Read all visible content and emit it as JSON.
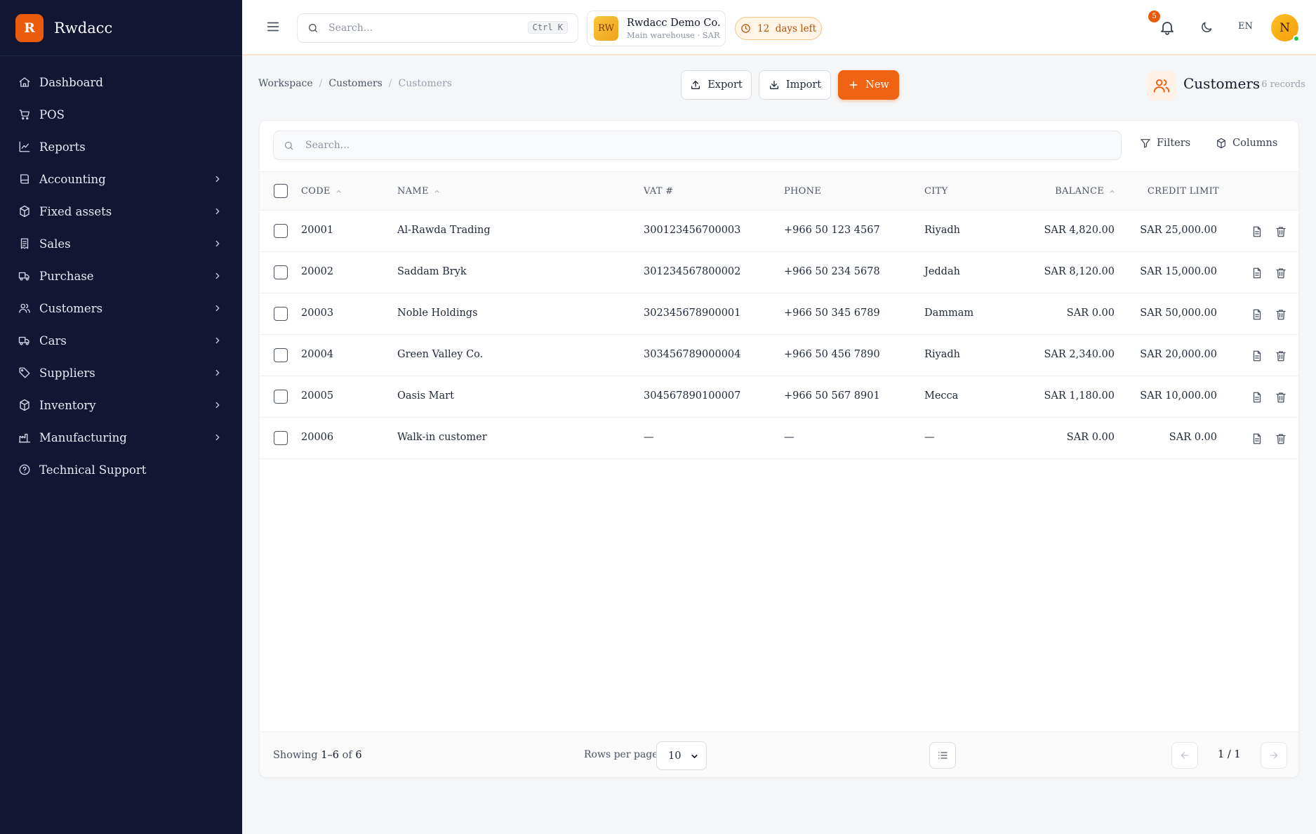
{
  "app": {
    "logo_letter": "R",
    "name": "Rwdacc"
  },
  "sidebar": {
    "items": [
      {
        "label": "Dashboard",
        "icon": "home-icon",
        "has_children": false
      },
      {
        "label": "POS",
        "icon": "cart-icon",
        "has_children": false
      },
      {
        "label": "Reports",
        "icon": "line-chart-icon",
        "has_children": false
      },
      {
        "label": "Accounting",
        "icon": "book-icon",
        "has_children": true
      },
      {
        "label": "Fixed assets",
        "icon": "box-icon",
        "has_children": true
      },
      {
        "label": "Sales",
        "icon": "receipt-icon",
        "has_children": true
      },
      {
        "label": "Purchase",
        "icon": "truck-icon",
        "has_children": true
      },
      {
        "label": "Customers",
        "icon": "users-icon",
        "has_children": true
      },
      {
        "label": "Cars",
        "icon": "car-icon",
        "has_children": true
      },
      {
        "label": "Suppliers",
        "icon": "tag-icon",
        "has_children": true
      },
      {
        "label": "Inventory",
        "icon": "package-icon",
        "has_children": true
      },
      {
        "label": "Manufacturing",
        "icon": "factory-icon",
        "has_children": true
      },
      {
        "label": "Technical Support",
        "icon": "help-circle-icon",
        "has_children": false
      }
    ]
  },
  "topbar": {
    "search_placeholder": "Search...",
    "shortcut": "Ctrl K",
    "company": {
      "avatar": "RW",
      "name": "Rwdacc Demo Co.",
      "sub": "Main warehouse · SAR"
    },
    "trial": "12  days left",
    "notifications_count": "5",
    "language": "EN",
    "user_initial": "N"
  },
  "breadcrumb": {
    "root": "Workspace",
    "section": "Customers",
    "current": "Customers"
  },
  "actions": {
    "export": "Export",
    "import": "Import",
    "new": "New"
  },
  "page": {
    "title": "Customers",
    "records": "· 6 records"
  },
  "table": {
    "search_placeholder": "Search...",
    "filters_label": "Filters",
    "columns_label": "Columns",
    "headers": {
      "code": "CODE",
      "name": "NAME",
      "vat": "VAT #",
      "phone": "PHONE",
      "city": "CITY",
      "balance": "BALANCE",
      "credit": "CREDIT LIMIT"
    },
    "rows": [
      {
        "code": "20001",
        "name": "Al-Rawda Trading",
        "vat": "300123456700003",
        "phone": "+966 50 123 4567",
        "city": "Riyadh",
        "balance": "SAR 4,820.00",
        "credit": "SAR 25,000.00"
      },
      {
        "code": "20002",
        "name": "Saddam Bryk",
        "vat": "301234567800002",
        "phone": "+966 50 234 5678",
        "city": "Jeddah",
        "balance": "SAR 8,120.00",
        "credit": "SAR 15,000.00"
      },
      {
        "code": "20003",
        "name": "Noble Holdings",
        "vat": "302345678900001",
        "phone": "+966 50 345 6789",
        "city": "Dammam",
        "balance": "SAR 0.00",
        "credit": "SAR 50,000.00"
      },
      {
        "code": "20004",
        "name": "Green Valley Co.",
        "vat": "303456789000004",
        "phone": "+966 50 456 7890",
        "city": "Riyadh",
        "balance": "SAR 2,340.00",
        "credit": "SAR 20,000.00"
      },
      {
        "code": "20005",
        "name": "Oasis Mart",
        "vat": "304567890100007",
        "phone": "+966 50 567 8901",
        "city": "Mecca",
        "balance": "SAR 1,180.00",
        "credit": "SAR 10,000.00"
      },
      {
        "code": "20006",
        "name": "Walk-in customer",
        "vat": "—",
        "phone": "—",
        "city": "—",
        "balance": "SAR 0.00",
        "credit": "SAR 0.00"
      }
    ]
  },
  "footer": {
    "showing_prefix": "Showing",
    "showing_range": "1–6",
    "showing_of": "of",
    "showing_total": "6",
    "rows_per_page_label": "Rows per page",
    "rows_per_page_value": "10",
    "page_info": "1 / 1"
  },
  "colors": {
    "sidebar_bg": "#131633",
    "accent": "#ef6313",
    "trial_text": "#b45309",
    "online": "#22c55e"
  }
}
